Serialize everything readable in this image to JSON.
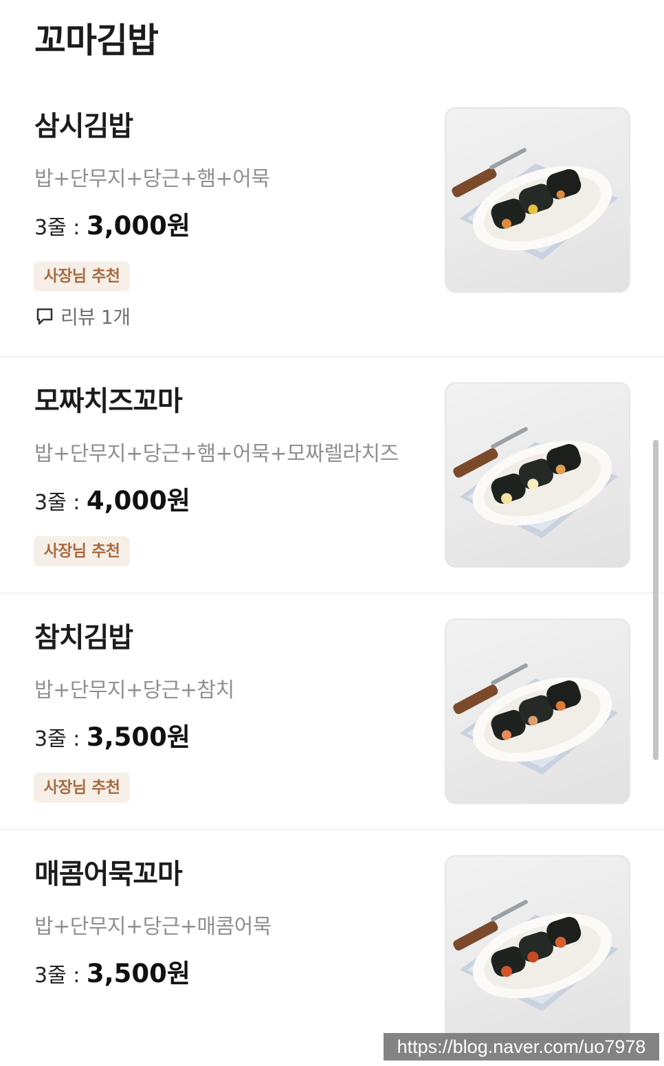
{
  "page": {
    "title": "꼬마김밥"
  },
  "items": [
    {
      "name": "삼시김밥",
      "description": "밥+단무지+당근+햄+어묵",
      "price_unit": "3줄 : ",
      "price": "3,000원",
      "badge": "사장님 추천",
      "review": "리뷰 1개"
    },
    {
      "name": "모짜치즈꼬마",
      "description": "밥+단무지+당근+햄+어묵+모짜렐라치즈",
      "price_unit": "3줄 : ",
      "price": "4,000원",
      "badge": "사장님 추천"
    },
    {
      "name": "참치김밥",
      "description": "밥+단무지+당근+참치",
      "price_unit": "3줄 : ",
      "price": "3,500원",
      "badge": "사장님 추천"
    },
    {
      "name": "매콤어묵꼬마",
      "description": "밥+단무지+당근+매콤어묵",
      "price_unit": "3줄 : ",
      "price": "3,500원"
    }
  ],
  "watermark": "https://blog.naver.com/uo7978",
  "icons": {
    "review": "speech-bubble-icon"
  },
  "colors": {
    "badge_bg": "#f6efe8",
    "badge_text": "#a86a3f",
    "description": "#8f8f8f"
  }
}
